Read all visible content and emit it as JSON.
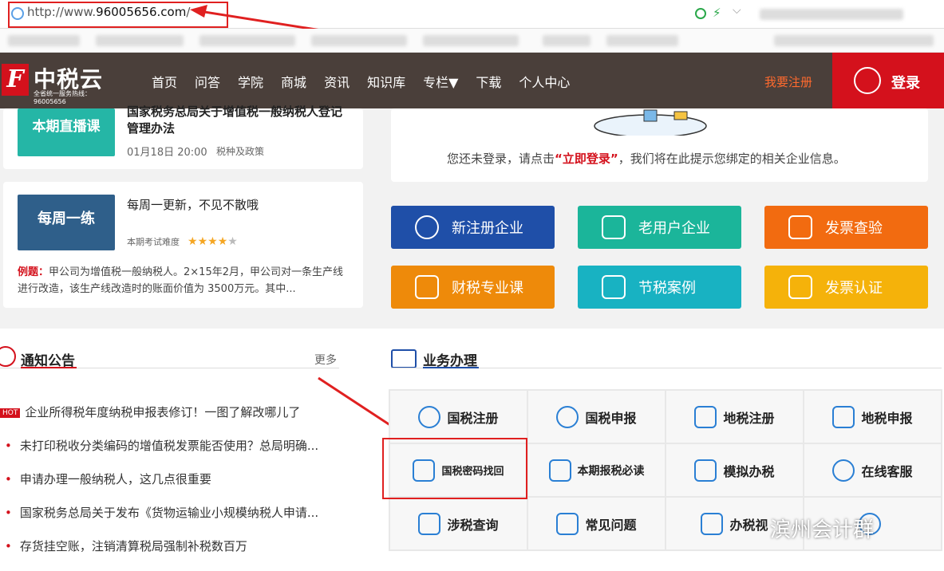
{
  "browser": {
    "url_prefix": "http://www.",
    "url_domain": "96005656.com",
    "url_suffix": "/"
  },
  "header": {
    "logo_name": "中税云",
    "logo_sub": "全省统一服务热线：96005656",
    "nav": [
      "首页",
      "问答",
      "学院",
      "商城",
      "资讯",
      "知识库",
      "专栏▼",
      "下载",
      "个人中心"
    ],
    "register": "我要注册",
    "login": "登录"
  },
  "live": {
    "thumb": "本期直播课",
    "title": "国家税务总局关于增值税一般纳税人登记管理办法",
    "time": "01月18日 20:00",
    "tag": "税种及政策"
  },
  "weekly": {
    "thumb": "每周一练",
    "title": "每周一更新，不见不散哦",
    "difficulty_label": "本期考试难度",
    "difficulty_stars": 4,
    "difficulty_max": 5,
    "example_label": "例题：",
    "example_text": "甲公司为增值税一般纳税人。2×15年2月，甲公司对一条生产线进行改造，该生产线改造时的账面价值为 3500万元。其中..."
  },
  "login_tip": {
    "before": "您还未登录，请点击",
    "link": "“立即登录”",
    "after": "，我们将在此提示您绑定的相关企业信息。"
  },
  "tiles": [
    {
      "label": "新注册企业",
      "color": "#1f4fa8"
    },
    {
      "label": "老用户企业",
      "color": "#1bb59a"
    },
    {
      "label": "发票查验",
      "color": "#f26b10"
    },
    {
      "label": "财税专业课",
      "color": "#ee8a0a"
    },
    {
      "label": "节税案例",
      "color": "#18b2c2"
    },
    {
      "label": "发票认证",
      "color": "#f5b20a"
    }
  ],
  "notice": {
    "title": "通知公告",
    "more": "更多",
    "hot": "HOT",
    "items": [
      "企业所得税年度纳税申报表修订！一图了解改哪儿了",
      "未打印税收分类编码的增值税发票能否使用？总局明确...",
      "申请办理一般纳税人，这几点很重要",
      "国家税务总局关于发布《货物运输业小规模纳税人申请...",
      "存货挂空账，注销清算税局强制补税数百万"
    ]
  },
  "business": {
    "title": "业务办理",
    "cells": [
      "国税注册",
      "国税申报",
      "地税注册",
      "地税申报",
      "国税密码找回",
      "本期报税必读",
      "模拟办税",
      "在线客服",
      "涉税查询",
      "常见问题",
      "办税视",
      ""
    ]
  },
  "watermark": "滨州会计群"
}
